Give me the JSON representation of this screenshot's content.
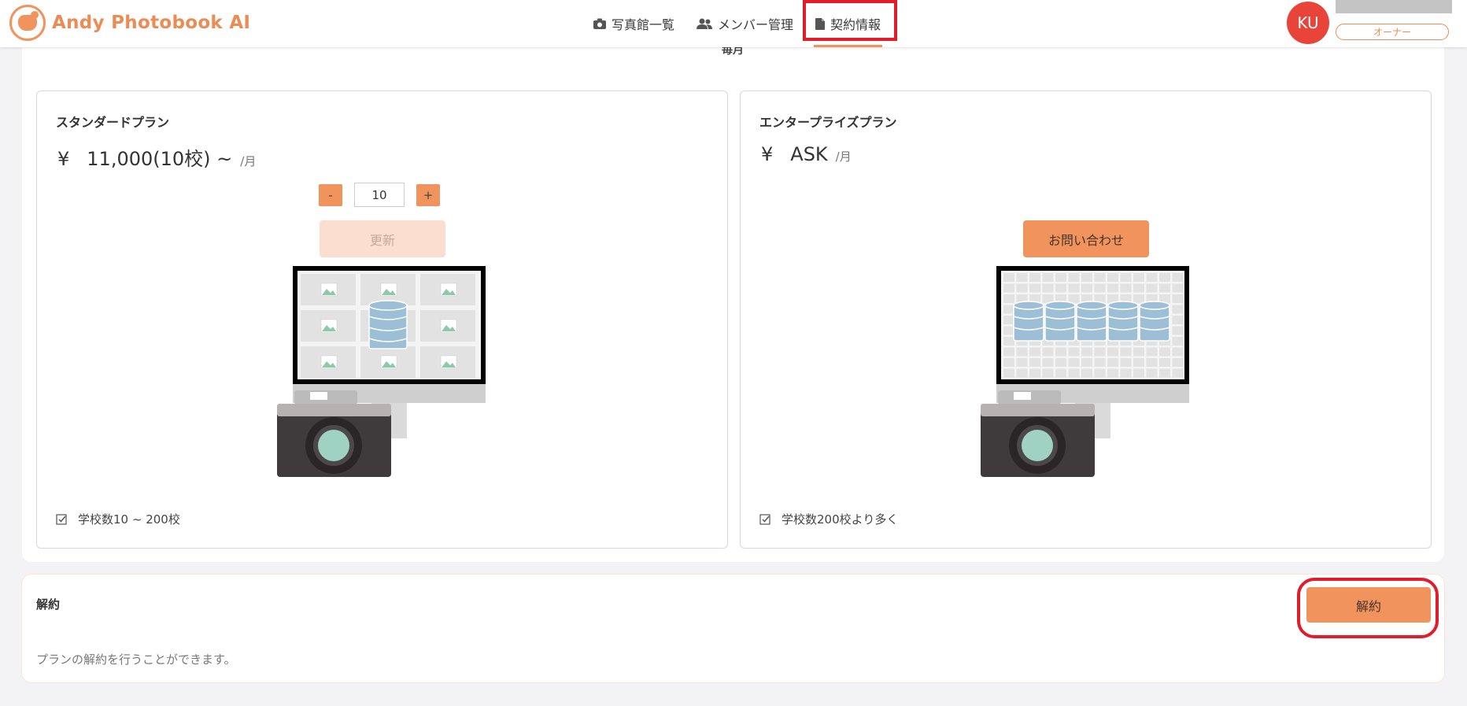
{
  "app": {
    "name": "Andy Photobook AI"
  },
  "nav": {
    "items": [
      {
        "label": "写真館一覧",
        "icon": "camera-icon"
      },
      {
        "label": "メンバー管理",
        "icon": "people-icon"
      },
      {
        "label": "契約情報",
        "icon": "document-icon",
        "active": true
      }
    ]
  },
  "user": {
    "initials": "KU",
    "role": "オーナー"
  },
  "billing_period": "毎月",
  "plans": [
    {
      "title": "スタンダードプラン",
      "currency": "¥",
      "price": "11,000(10校) ~",
      "unit": "/月",
      "stepper": {
        "decrement": "-",
        "value": "10",
        "increment": "+"
      },
      "action": "更新",
      "action_disabled": true,
      "feature": "学校数10 ~ 200校"
    },
    {
      "title": "エンタープライズプラン",
      "currency": "¥",
      "price": "ASK",
      "unit": "/月",
      "action": "お問い合わせ",
      "feature": "学校数200校より多く"
    }
  ],
  "cancel": {
    "title": "解約",
    "description": "プランの解約を行うことができます。",
    "button": "解約"
  },
  "colors": {
    "accent": "#f0935c",
    "accent_light": "#fbded0",
    "avatar": "#e8443a",
    "highlight": "#e11d2b"
  }
}
